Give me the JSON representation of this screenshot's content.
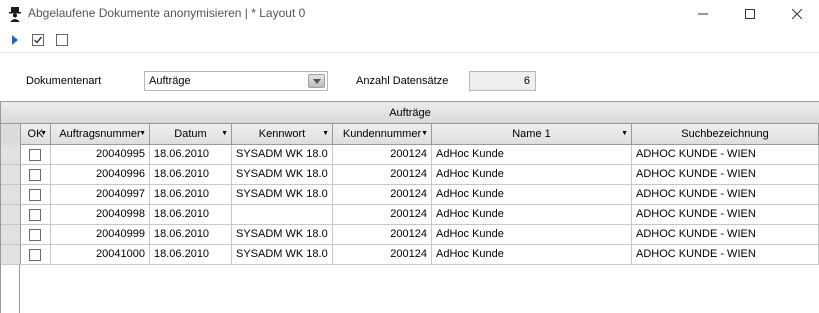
{
  "window": {
    "title": "Abgelaufene Dokumente anonymisieren | * Layout 0",
    "icon": "hat-person-icon"
  },
  "toolbar": {
    "buttons": [
      "play-icon",
      "check-all-icon",
      "uncheck-all-icon"
    ]
  },
  "filter": {
    "doctype_label": "Dokumentenart",
    "doctype_value": "Aufträge",
    "count_label": "Anzahl Datensätze",
    "count_value": "6"
  },
  "grid": {
    "caption": "Aufträge",
    "columns": [
      "OK",
      "Auftragsnummer",
      "Datum",
      "Kennwort",
      "Kundennummer",
      "Name 1",
      "Suchbezeichnung"
    ],
    "rows": [
      {
        "ok": false,
        "auftragsnummer": "20040995",
        "datum": "18.06.2010",
        "kennwort": "SYSADM WK 18.0",
        "kundennummer": "200124",
        "name1": "AdHoc Kunde",
        "suchbezeichnung": "ADHOC KUNDE - WIEN"
      },
      {
        "ok": false,
        "auftragsnummer": "20040996",
        "datum": "18.06.2010",
        "kennwort": "SYSADM WK 18.0",
        "kundennummer": "200124",
        "name1": "AdHoc Kunde",
        "suchbezeichnung": "ADHOC KUNDE - WIEN"
      },
      {
        "ok": false,
        "auftragsnummer": "20040997",
        "datum": "18.06.2010",
        "kennwort": "SYSADM WK 18.0",
        "kundennummer": "200124",
        "name1": "AdHoc Kunde",
        "suchbezeichnung": "ADHOC KUNDE - WIEN"
      },
      {
        "ok": false,
        "auftragsnummer": "20040998",
        "datum": "18.06.2010",
        "kennwort": "",
        "kundennummer": "200124",
        "name1": "AdHoc Kunde",
        "suchbezeichnung": "ADHOC KUNDE - WIEN"
      },
      {
        "ok": false,
        "auftragsnummer": "20040999",
        "datum": "18.06.2010",
        "kennwort": "SYSADM WK 18.0",
        "kundennummer": "200124",
        "name1": "AdHoc Kunde",
        "suchbezeichnung": "ADHOC KUNDE - WIEN"
      },
      {
        "ok": false,
        "auftragsnummer": "20041000",
        "datum": "18.06.2010",
        "kennwort": "SYSADM WK 18.0",
        "kundennummer": "200124",
        "name1": "AdHoc Kunde",
        "suchbezeichnung": "ADHOC KUNDE - WIEN"
      }
    ]
  }
}
